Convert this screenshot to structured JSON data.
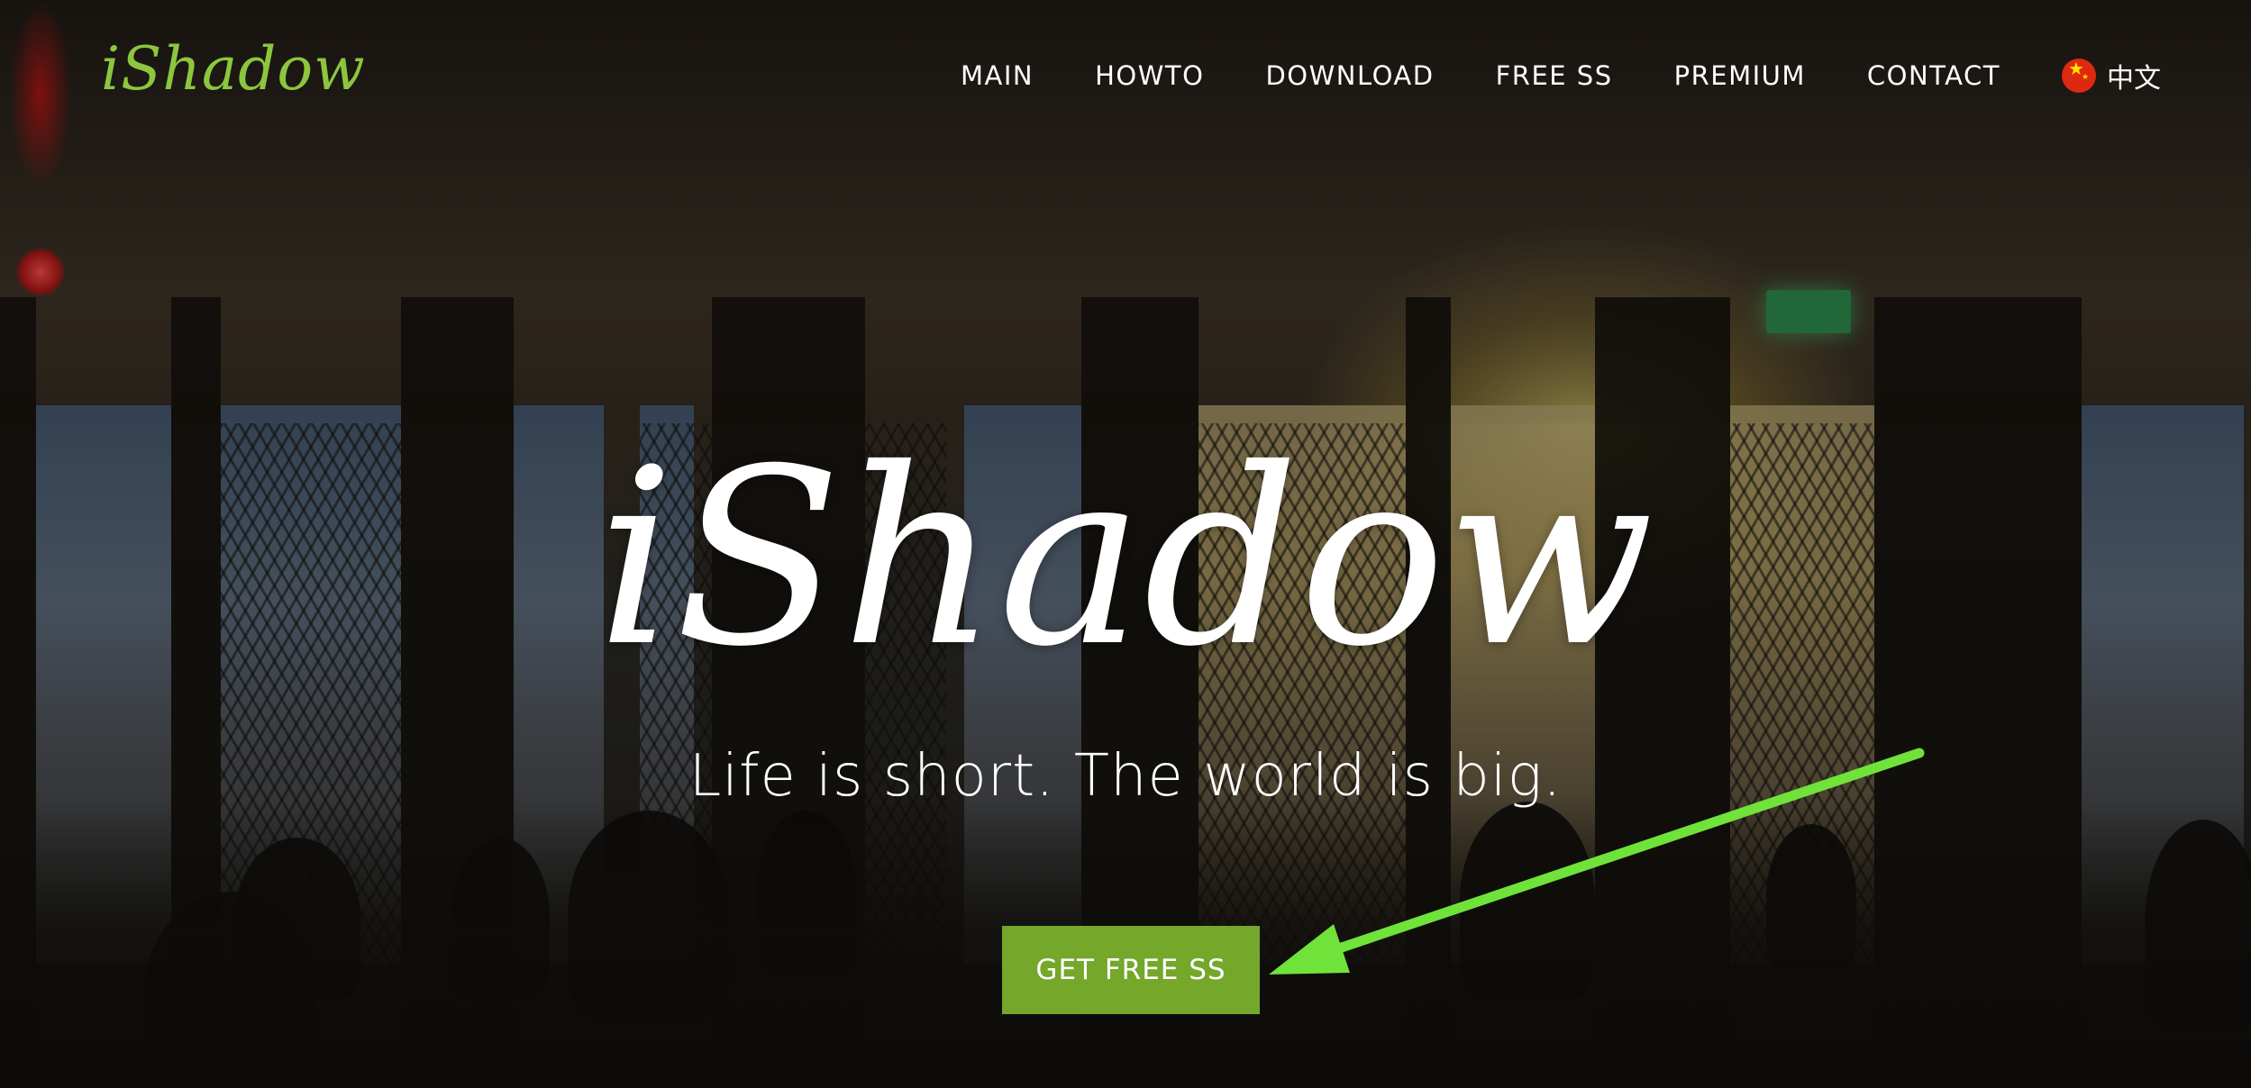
{
  "header": {
    "logo": "iShadow",
    "nav": [
      {
        "label": "MAIN"
      },
      {
        "label": "HOWTO"
      },
      {
        "label": "DOWNLOAD"
      },
      {
        "label": "FREE SS"
      },
      {
        "label": "PREMIUM"
      },
      {
        "label": "CONTACT"
      }
    ],
    "language": {
      "icon": "china-flag-icon",
      "label": "中文"
    }
  },
  "hero": {
    "title": "iShadow",
    "tagline": "Life is short. The world is big.",
    "cta_label": "GET FREE SS"
  },
  "annotation": {
    "icon": "arrow-pointer-icon",
    "color": "#6fe33a"
  },
  "colors": {
    "brand": "#8cc63f",
    "cta": "#74a72a",
    "text": "#ffffff"
  }
}
